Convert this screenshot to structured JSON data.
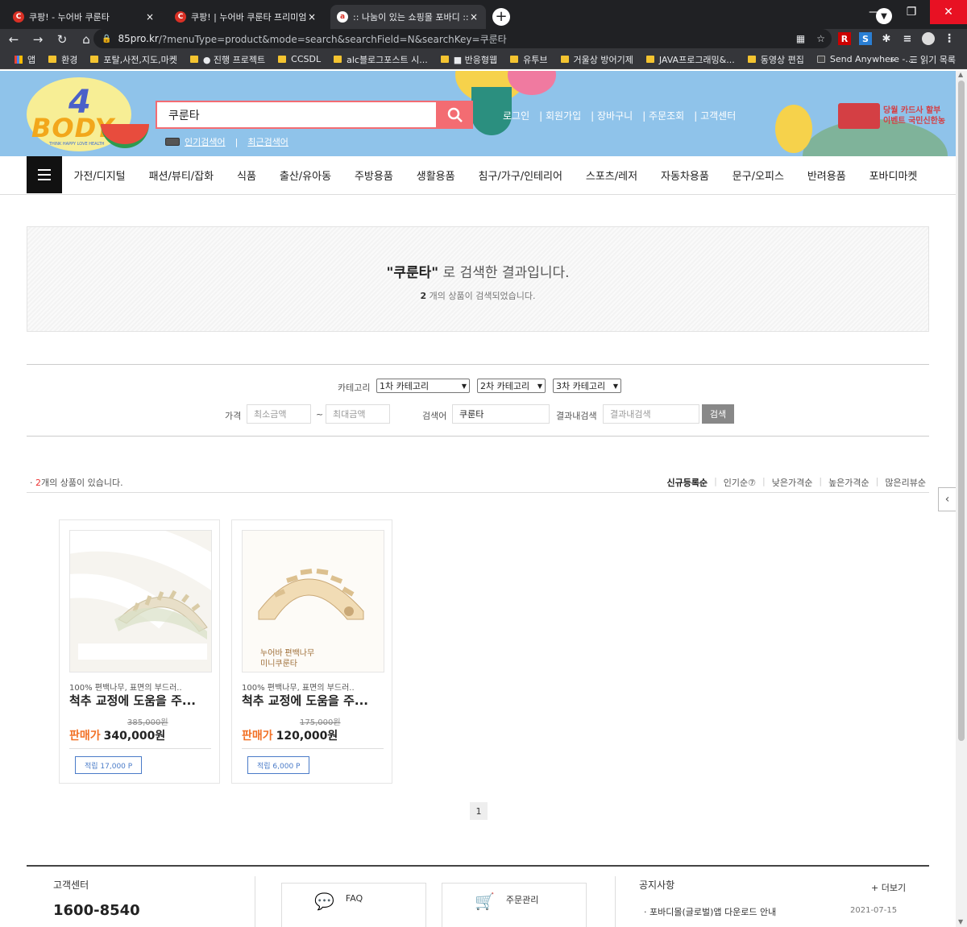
{
  "browser": {
    "tabs": [
      {
        "favicon": "C",
        "title": "쿠팡! - 누어바 쿠룬타",
        "close": "×"
      },
      {
        "favicon": "C",
        "title": "쿠팡! | 누어바 쿠룬타 프리미엄",
        "close": "×"
      },
      {
        "favicon": "a",
        "title": ":: 나눔이 있는 쇼핑몰 포바디 ::",
        "close": "×"
      }
    ],
    "new_tab": "+",
    "window_controls": {
      "minimize": "—",
      "maximize": "❐",
      "close": "✕"
    },
    "nav": {
      "back": "←",
      "forward": "→",
      "reload": "↻",
      "home": "⌂"
    },
    "url_host": "85pro.kr",
    "url_path": "/?menuType=product&mode=search&searchField=N&searchKey=쿠룬타",
    "bookmarks": [
      {
        "label": "앱",
        "kind": "grid"
      },
      {
        "label": "환경",
        "kind": "folder"
      },
      {
        "label": "포탈,사전,지도,마켓",
        "kind": "folder"
      },
      {
        "label": "● 진행 프로젝트",
        "kind": "folder"
      },
      {
        "label": "CCSDL",
        "kind": "folder"
      },
      {
        "label": "alc블로그포스트 시...",
        "kind": "folder"
      },
      {
        "label": "■ 반응형웹",
        "kind": "folder"
      },
      {
        "label": "유투브",
        "kind": "folder"
      },
      {
        "label": "거울상 방어기제",
        "kind": "folder"
      },
      {
        "label": "JAVA프로그래밍&...",
        "kind": "folder"
      },
      {
        "label": "동영상 편집",
        "kind": "folder"
      },
      {
        "label": "Send Anywhere -...",
        "kind": "site"
      }
    ],
    "bookmarks_more": "»",
    "reading_list": "읽기 목록"
  },
  "header": {
    "logo_number": "4",
    "logo_word": "BODY",
    "logo_tagline": "THINK HAPPY LOVE HEALTH",
    "search_value": "쿠룬타",
    "popular_link": "인기검색어",
    "recent_link": "최근검색어",
    "top_links": [
      "로그인",
      "| 회원가입",
      "| 장바구니",
      "| 주문조회",
      "| 고객센터"
    ],
    "promo_line1": "당월 카드사 할부",
    "promo_line2": "이벤트 국민신한농"
  },
  "categories": [
    "가전/디지털",
    "패션/뷰티/잡화",
    "식품",
    "출산/유아동",
    "주방용품",
    "생활용품",
    "침구/가구/인테리어",
    "스포츠/레저",
    "자동차용품",
    "문구/오피스",
    "반려용품",
    "포바디마켓"
  ],
  "result": {
    "keyword": "\"쿠룬타\"",
    "title_suffix": "로 검색한 결과입니다.",
    "count_num": "2",
    "count_suffix": "개의 상품이 검색되었습니다."
  },
  "filter": {
    "category_label": "카테고리",
    "cat1": "1차 카테고리",
    "cat2": "2차 카테고리",
    "cat3": "3차 카테고리",
    "price_label": "가격",
    "min_placeholder": "최소금액",
    "tilde": "~",
    "max_placeholder": "최대금액",
    "keyword_label": "검색어",
    "keyword_value": "쿠룬타",
    "within_label": "결과내검색",
    "within_placeholder": "결과내검색",
    "search_button": "검색"
  },
  "list": {
    "count_num": "2",
    "count_suffix": "개의 상품이 있습니다.",
    "sorts": [
      "신규등록순",
      "인기순⑦",
      "낮은가격순",
      "높은가격순",
      "많은리뷰순"
    ]
  },
  "products": [
    {
      "desc": "100% 편백나무, 표면의 부드러..",
      "name": "척추 교정에 도움을 주...",
      "original_price": "385,000원",
      "sale_label": "판매가",
      "sale_price": "340,000원",
      "points": "적립 17,000 P",
      "image_text": ""
    },
    {
      "desc": "100% 편백나무, 표면의 부드러..",
      "name": "척추 교정에 도움을 주...",
      "original_price": "175,000원",
      "sale_label": "판매가",
      "sale_price": "120,000원",
      "points": "적립 6,000 P",
      "image_text_1": "누어바 편백나무",
      "image_text_2": "미니쿠룬타"
    }
  ],
  "pagination": {
    "current": "1"
  },
  "footer": {
    "cs_title": "고객센터",
    "cs_phone": "1600-8540",
    "faq": "FAQ",
    "orders": "주문관리",
    "notice_title": "공지사항",
    "notice_more": "+ 더보기",
    "notice_item": "· 포바디몰(글로벌)앱 다운로드 안내",
    "notice_date": "2021-07-15"
  }
}
